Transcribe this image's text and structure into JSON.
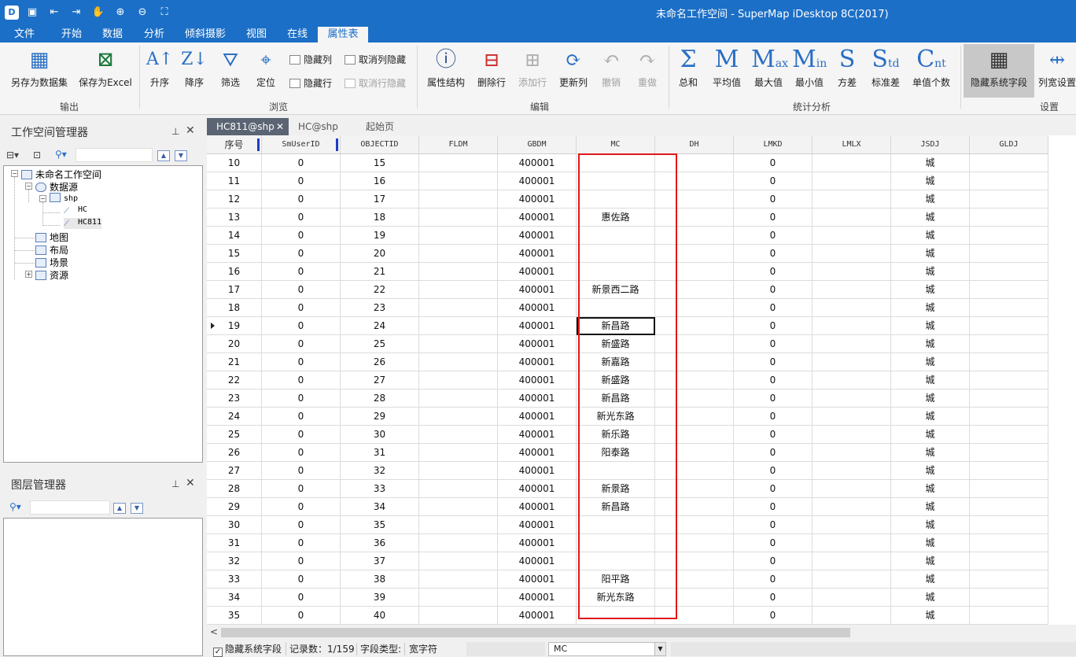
{
  "window": {
    "title": "未命名工作空间 - SuperMap iDesktop 8C(2017)"
  },
  "menu": {
    "tabs": [
      "文件",
      "开始",
      "数据",
      "分析",
      "倾斜摄影",
      "视图",
      "在线",
      "属性表"
    ],
    "active": "属性表"
  },
  "ribbon": {
    "output": {
      "save_dataset": "另存为数据集",
      "save_excel": "保存为Excel",
      "group": "输出"
    },
    "browse": {
      "asc": "升序",
      "desc": "降序",
      "filter": "筛选",
      "locate": "定位",
      "hide_col": "隐藏列",
      "unhide_col": "取消列隐藏",
      "hide_row": "隐藏行",
      "unhide_row": "取消行隐藏",
      "group": "浏览"
    },
    "edit": {
      "attr_struct": "属性结构",
      "del_row": "删除行",
      "add_row": "添加行",
      "update_col": "更新列",
      "undo": "撤销",
      "redo": "重做",
      "group": "编辑"
    },
    "stats": {
      "sum": "总和",
      "avg": "平均值",
      "max": "最大值",
      "min": "最小值",
      "variance": "方差",
      "stddev": "标准差",
      "unique": "单值个数",
      "group": "统计分析"
    },
    "settings": {
      "hide_sys": "隐藏系统字段",
      "col_width": "列宽设置",
      "group": "设置"
    }
  },
  "workspace_panel": {
    "title": "工作空间管理器",
    "tree": {
      "root": "未命名工作空间",
      "datasource": "数据源",
      "shp": "shp",
      "hc": "HC",
      "hc811": "HC811",
      "map": "地图",
      "layout": "布局",
      "scene": "场景",
      "resource": "资源"
    }
  },
  "layer_panel": {
    "title": "图层管理器"
  },
  "doc_tabs": {
    "tab1": "HC811@shp",
    "tab2": "HC@shp",
    "tab3": "起始页"
  },
  "table": {
    "columns": [
      "序号",
      "SmUserID",
      "OBJECTID",
      "FLDM",
      "GBDM",
      "MC",
      "DH",
      "LMKD",
      "LMLX",
      "JSDJ",
      "GLDJ"
    ],
    "rows": [
      [
        "10",
        "0",
        "15",
        "",
        "400001",
        "",
        "",
        "0",
        "",
        "城",
        ""
      ],
      [
        "11",
        "0",
        "16",
        "",
        "400001",
        "",
        "",
        "0",
        "",
        "城",
        ""
      ],
      [
        "12",
        "0",
        "17",
        "",
        "400001",
        "",
        "",
        "0",
        "",
        "城",
        ""
      ],
      [
        "13",
        "0",
        "18",
        "",
        "400001",
        "惠佐路",
        "",
        "0",
        "",
        "城",
        ""
      ],
      [
        "14",
        "0",
        "19",
        "",
        "400001",
        "",
        "",
        "0",
        "",
        "城",
        ""
      ],
      [
        "15",
        "0",
        "20",
        "",
        "400001",
        "",
        "",
        "0",
        "",
        "城",
        ""
      ],
      [
        "16",
        "0",
        "21",
        "",
        "400001",
        "",
        "",
        "0",
        "",
        "城",
        ""
      ],
      [
        "17",
        "0",
        "22",
        "",
        "400001",
        "新景西二路",
        "",
        "0",
        "",
        "城",
        ""
      ],
      [
        "18",
        "0",
        "23",
        "",
        "400001",
        "",
        "",
        "0",
        "",
        "城",
        ""
      ],
      [
        "19",
        "0",
        "24",
        "",
        "400001",
        "新昌路",
        "",
        "0",
        "",
        "城",
        ""
      ],
      [
        "20",
        "0",
        "25",
        "",
        "400001",
        "新盛路",
        "",
        "0",
        "",
        "城",
        ""
      ],
      [
        "21",
        "0",
        "26",
        "",
        "400001",
        "新嘉路",
        "",
        "0",
        "",
        "城",
        ""
      ],
      [
        "22",
        "0",
        "27",
        "",
        "400001",
        "新盛路",
        "",
        "0",
        "",
        "城",
        ""
      ],
      [
        "23",
        "0",
        "28",
        "",
        "400001",
        "新昌路",
        "",
        "0",
        "",
        "城",
        ""
      ],
      [
        "24",
        "0",
        "29",
        "",
        "400001",
        "新光东路",
        "",
        "0",
        "",
        "城",
        ""
      ],
      [
        "25",
        "0",
        "30",
        "",
        "400001",
        "新乐路",
        "",
        "0",
        "",
        "城",
        ""
      ],
      [
        "26",
        "0",
        "31",
        "",
        "400001",
        "阳泰路",
        "",
        "0",
        "",
        "城",
        ""
      ],
      [
        "27",
        "0",
        "32",
        "",
        "400001",
        "",
        "",
        "0",
        "",
        "城",
        ""
      ],
      [
        "28",
        "0",
        "33",
        "",
        "400001",
        "新景路",
        "",
        "0",
        "",
        "城",
        ""
      ],
      [
        "29",
        "0",
        "34",
        "",
        "400001",
        "新昌路",
        "",
        "0",
        "",
        "城",
        ""
      ],
      [
        "30",
        "0",
        "35",
        "",
        "400001",
        "",
        "",
        "0",
        "",
        "城",
        ""
      ],
      [
        "31",
        "0",
        "36",
        "",
        "400001",
        "",
        "",
        "0",
        "",
        "城",
        ""
      ],
      [
        "32",
        "0",
        "37",
        "",
        "400001",
        "",
        "",
        "0",
        "",
        "城",
        ""
      ],
      [
        "33",
        "0",
        "38",
        "",
        "400001",
        "阳平路",
        "",
        "0",
        "",
        "城",
        ""
      ],
      [
        "34",
        "0",
        "39",
        "",
        "400001",
        "新光东路",
        "",
        "0",
        "",
        "城",
        ""
      ],
      [
        "35",
        "0",
        "40",
        "",
        "400001",
        "",
        "",
        "0",
        "",
        "城",
        ""
      ]
    ],
    "current_row": "19",
    "selected_column": "MC"
  },
  "status": {
    "hide_sys": "隐藏系统字段",
    "record_count": "记录数：1/159",
    "field_type_label": "字段类型:",
    "field_type_value": "宽字符",
    "field_select": "MC"
  }
}
